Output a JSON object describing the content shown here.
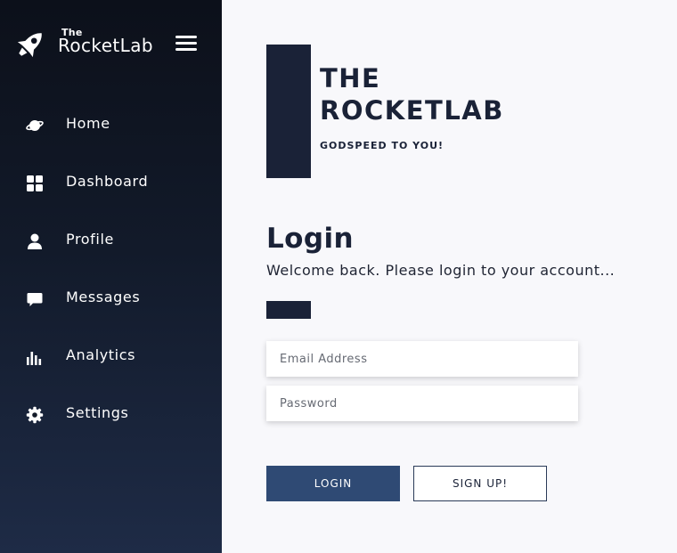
{
  "brand": {
    "the": "The",
    "name": "RocketLab"
  },
  "nav": {
    "items": [
      {
        "label": "Home",
        "icon": "planet-icon"
      },
      {
        "label": "Dashboard",
        "icon": "grid-icon"
      },
      {
        "label": "Profile",
        "icon": "user-icon"
      },
      {
        "label": "Messages",
        "icon": "chat-icon"
      },
      {
        "label": "Analytics",
        "icon": "bar-chart-icon"
      },
      {
        "label": "Settings",
        "icon": "gear-icon"
      }
    ]
  },
  "hero": {
    "title_line1": "THE",
    "title_line2": "ROCKETLAB",
    "subtitle": "GODSPEED TO YOU!"
  },
  "login": {
    "title": "Login",
    "subtitle": "Welcome back. Please login to your account...",
    "email_placeholder": "Email Address",
    "password_placeholder": "Password",
    "login_label": "LOGIN",
    "signup_label": "SIGN UP!"
  },
  "colors": {
    "sidebar_top": "#0c101a",
    "sidebar_bottom": "#1e2b46",
    "accent": "#1a2237",
    "button": "#2f4a74"
  }
}
